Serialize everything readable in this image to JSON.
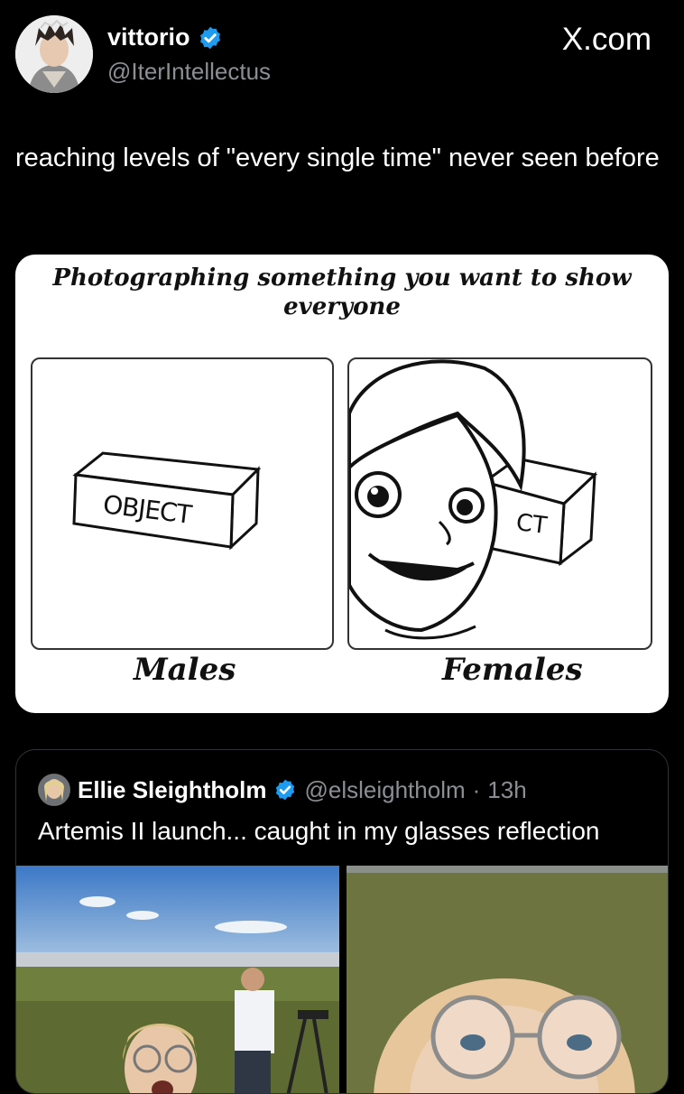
{
  "post": {
    "author_name": "vittorio",
    "author_handle": "@IterIntellectus",
    "brand": "X.com",
    "text": "reaching levels of \"every single time\" never seen before"
  },
  "meme": {
    "title": "Photographing something you want to show everyone",
    "object_label": "OBJECT",
    "object_label_partial": "CT",
    "left_caption": "Males",
    "right_caption": "Females"
  },
  "quoted": {
    "name": "Ellie Sleightholm",
    "handle": "@elsleightholm",
    "separator": "·",
    "time": "13h",
    "text": "Artemis II launch... caught in my glasses reflection"
  },
  "colors": {
    "verified_blue": "#1d9bf0",
    "background": "#000000"
  },
  "icons": [
    "verified-badge-icon",
    "avatar"
  ]
}
